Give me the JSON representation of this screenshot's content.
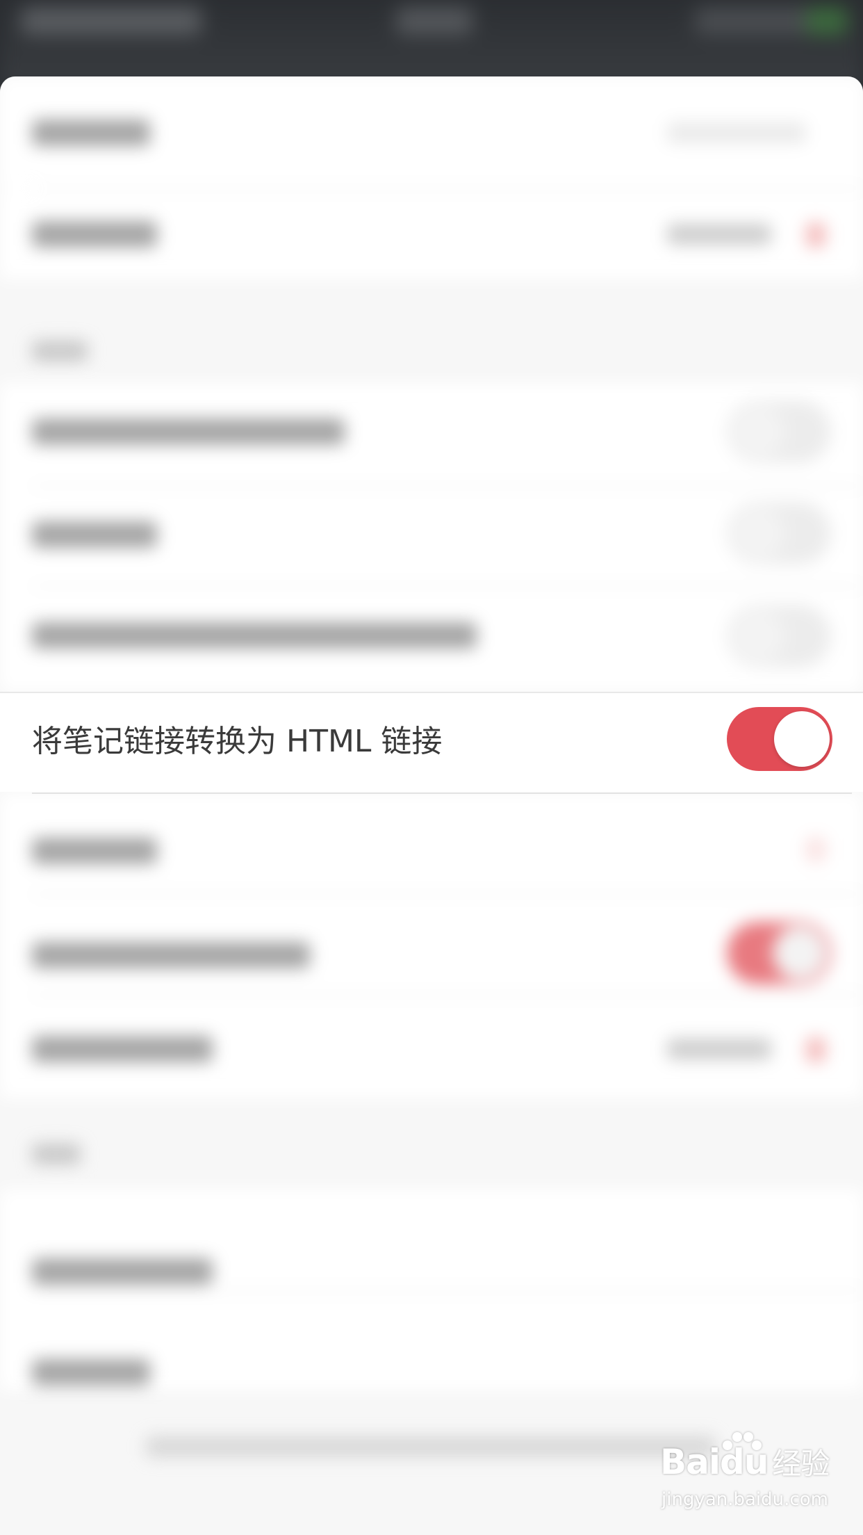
{
  "settings": {
    "focused_row": {
      "label": "将笔记链接转换为 HTML 链接",
      "toggle_state": "on",
      "toggle_color": "#e24c56"
    }
  },
  "watermark": {
    "brand": "Bai",
    "brand_tail": "du",
    "brand_cn": "经验",
    "url": "jingyan.baidu.com"
  }
}
